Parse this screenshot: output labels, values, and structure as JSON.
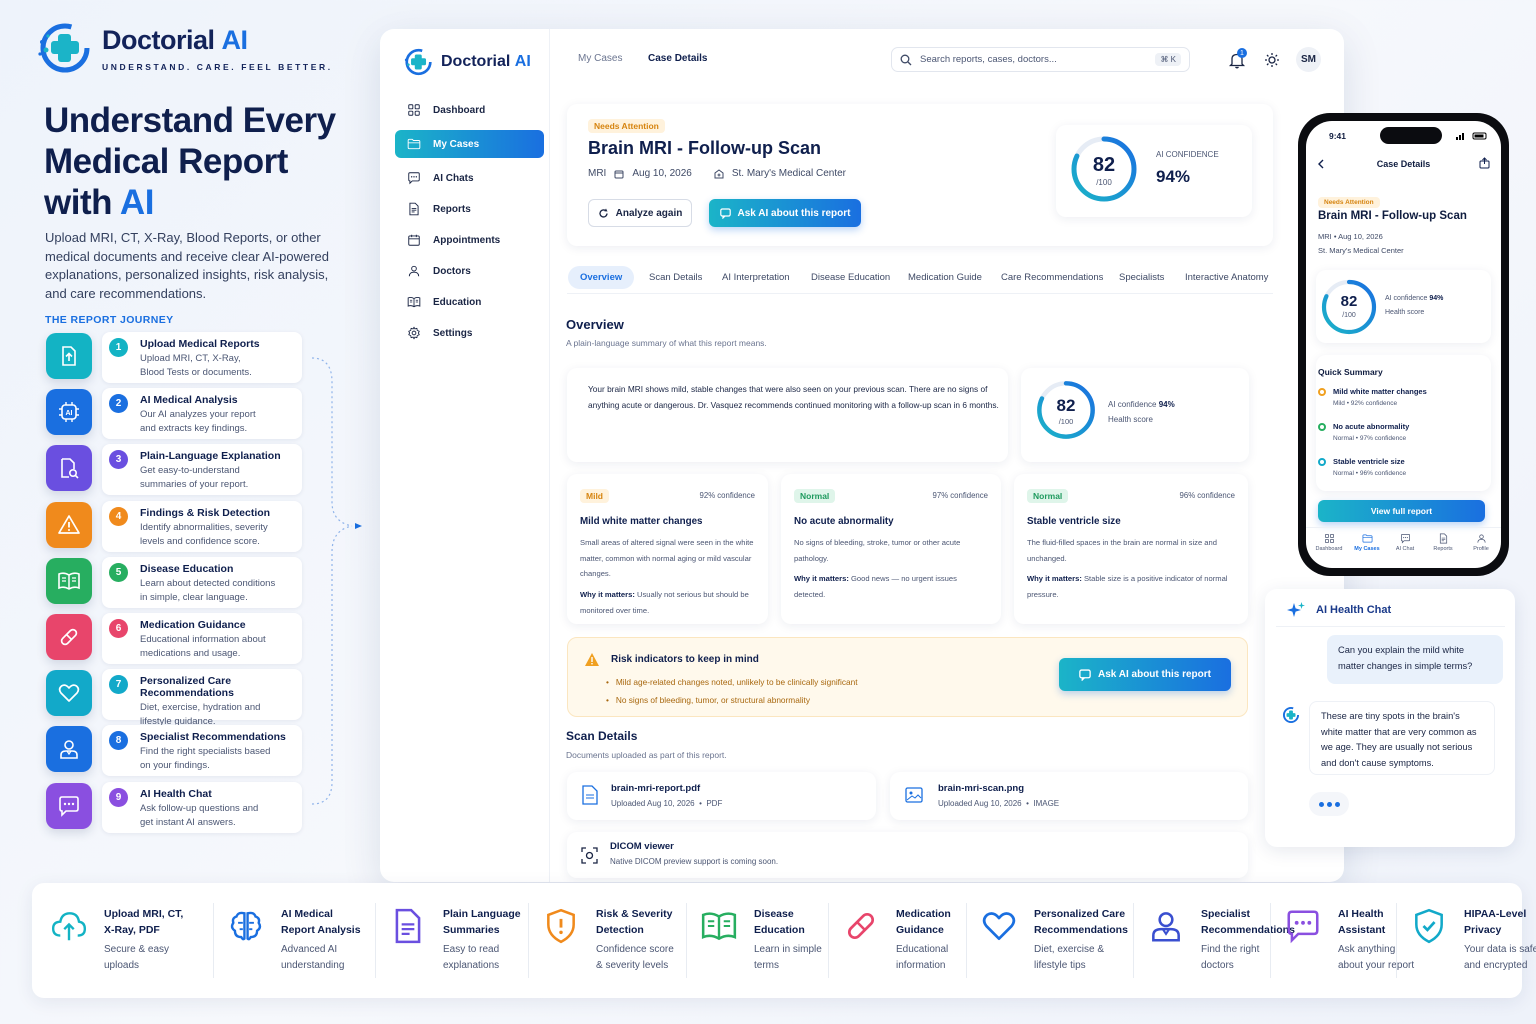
{
  "hero": {
    "brand_a": "Doctorial",
    "brand_b": "AI",
    "tagline": "UNDERSTAND. CARE. FEEL BETTER.",
    "title_a": "Understand Every Medical Report with",
    "title_b": "AI",
    "description": "Upload MRI, CT, X-Ray, Blood Reports, or other medical documents and receive clear AI-powered explanations, personalized insights, risk analysis, and care recommendations.",
    "journey_title": "THE REPORT JOURNEY"
  },
  "journey": [
    {
      "num": "1",
      "title": "Upload Medical Reports",
      "desc1": "Upload MRI, CT, X-Ray,",
      "desc2": "Blood Tests or documents.",
      "color": "#13b3c4",
      "icon": "upload-document-icon"
    },
    {
      "num": "2",
      "title": "AI Medical Analysis",
      "desc1": "Our AI analyzes your report",
      "desc2": "and extracts key findings.",
      "color": "#1a6fe0",
      "icon": "ai-chip-icon"
    },
    {
      "num": "3",
      "title": "Plain-Language Explanation",
      "desc1": "Get easy-to-understand",
      "desc2": "summaries of your report.",
      "color": "#6a4fe0",
      "icon": "document-search-icon"
    },
    {
      "num": "4",
      "title": "Findings & Risk Detection",
      "desc1": "Identify abnormalities, severity",
      "desc2": "levels and confidence score.",
      "color": "#f08a1c",
      "icon": "warning-icon"
    },
    {
      "num": "5",
      "title": "Disease Education",
      "desc1": "Learn about detected conditions",
      "desc2": "in simple, clear language.",
      "color": "#27ae60",
      "icon": "book-icon"
    },
    {
      "num": "6",
      "title": "Medication Guidance",
      "desc1": "Educational information about",
      "desc2": "medications and usage.",
      "color": "#e8456b",
      "icon": "pill-icon"
    },
    {
      "num": "7",
      "title": "Personalized Care Recommendations",
      "desc1": "Diet, exercise, hydration and",
      "desc2": "lifestyle guidance.",
      "color": "#12a9c9",
      "icon": "heart-icon"
    },
    {
      "num": "8",
      "title": "Specialist Recommendations",
      "desc1": "Find the right specialists based",
      "desc2": "on your findings.",
      "color": "#1a6fe0",
      "icon": "doctor-icon"
    },
    {
      "num": "9",
      "title": "AI Health Chat",
      "desc1": "Ask follow-up questions and",
      "desc2": "get instant AI answers.",
      "color": "#8a4fe0",
      "icon": "chat-icon"
    }
  ],
  "app": {
    "brand_a": "Doctorial",
    "brand_b": "AI",
    "nav": [
      {
        "label": "Dashboard",
        "icon": "grid-icon"
      },
      {
        "label": "My Cases",
        "icon": "folder-icon"
      },
      {
        "label": "AI Chats",
        "icon": "chat-icon"
      },
      {
        "label": "Reports",
        "icon": "document-icon"
      },
      {
        "label": "Appointments",
        "icon": "calendar-icon"
      },
      {
        "label": "Doctors",
        "icon": "user-icon"
      },
      {
        "label": "Education",
        "icon": "book-icon"
      },
      {
        "label": "Settings",
        "icon": "gear-icon"
      }
    ],
    "breadcrumb": {
      "parent": "My Cases",
      "current": "Case Details"
    },
    "search_placeholder": "Search reports, cases, doctors...",
    "shortcut": "⌘ K",
    "notifications": "1",
    "avatar": "SM",
    "case": {
      "badge": "Needs Attention",
      "title": "Brain MRI - Follow-up Scan",
      "type": "MRI",
      "date": "Aug 10, 2026",
      "facility": "St. Mary's Medical Center",
      "analyze_label": "Analyze again",
      "ask_label": "Ask AI about this report",
      "score": "82",
      "score_max": "/100",
      "score_value": 82,
      "confidence_label": "AI CONFIDENCE",
      "confidence": "94%"
    },
    "tabs": [
      "Overview",
      "Scan Details",
      "AI Interpretation",
      "Disease Education",
      "Medication Guide",
      "Care Recommendations",
      "Specialists",
      "Interactive Anatomy"
    ],
    "overview": {
      "title": "Overview",
      "subtitle": "A plain-language summary of what this report means.",
      "summary": "Your brain MRI shows mild, stable changes that were also seen on your previous scan. There are no signs of anything acute or dangerous. Dr. Vasquez recommends continued monitoring with a follow-up scan in 6 months.",
      "score": "82",
      "score_max": "/100",
      "confidence_prefix": "AI confidence",
      "confidence": "94%",
      "health_label": "Health score"
    },
    "findings": [
      {
        "badge": "Mild",
        "kind": "mild",
        "confidence": "92% confidence",
        "title": "Mild white matter changes",
        "desc": "Small areas of altered signal were seen in the white matter, common with normal aging or mild vascular changes.",
        "why_label": "Why it matters:",
        "why": " Usually not serious but should be monitored over time."
      },
      {
        "badge": "Normal",
        "kind": "norm",
        "confidence": "97% confidence",
        "title": "No acute abnormality",
        "desc": "No signs of bleeding, stroke, tumor or other acute pathology.",
        "why_label": "Why it matters:",
        "why": " Good news — no urgent issues detected."
      },
      {
        "badge": "Normal",
        "kind": "norm",
        "confidence": "96% confidence",
        "title": "Stable ventricle size",
        "desc": "The fluid-filled spaces in the brain are normal in size and unchanged.",
        "why_label": "Why it matters:",
        "why": " Stable size is a positive indicator of normal pressure."
      }
    ],
    "risk": {
      "title": "Risk indicators to keep in mind",
      "items": [
        "Mild age-related changes noted, unlikely to be clinically significant",
        "No signs of bleeding, tumor, or structural abnormality"
      ],
      "ask_label": "Ask AI about this report"
    },
    "scan": {
      "title": "Scan Details",
      "subtitle": "Documents uploaded as part of this report.",
      "files": [
        {
          "name": "brain-mri-report.pdf",
          "meta": "Uploaded Aug 10, 2026",
          "kind": "PDF"
        },
        {
          "name": "brain-mri-scan.png",
          "meta": "Uploaded Aug 10, 2026",
          "kind": "IMAGE"
        }
      ],
      "dicom_title": "DICOM viewer",
      "dicom_desc": "Native DICOM preview support is coming soon."
    }
  },
  "phone": {
    "time": "9:41",
    "title": "Case Details",
    "badge": "Needs Attention",
    "case_title": "Brain MRI - Follow-up Scan",
    "meta": "MRI  •  Aug 10, 2026",
    "facility": "St. Mary's Medical Center",
    "score": "82",
    "score_max": "/100",
    "conf_prefix": "AI confidence",
    "conf": "94%",
    "health": "Health score",
    "quick_title": "Quick Summary",
    "items": [
      {
        "title": "Mild white matter changes",
        "meta": "Mild  •  92% confidence",
        "color": "#f0a020"
      },
      {
        "title": "No acute abnormality",
        "meta": "Normal  •  97% confidence",
        "color": "#27ae60"
      },
      {
        "title": "Stable ventricle size",
        "meta": "Normal  •  96% confidence",
        "color": "#12a9c9"
      }
    ],
    "button": "View full report",
    "tabs": [
      "Dashboard",
      "My Cases",
      "AI Chat",
      "Reports",
      "Profile"
    ]
  },
  "chat": {
    "title": "AI Health Chat",
    "user_msg": "Can you explain the mild white matter changes in simple terms?",
    "ai_msg": "These are tiny spots in the brain's white matter that are very common as we age. They are usually not serious and don't cause symptoms."
  },
  "features": [
    {
      "t1": "Upload MRI, CT,",
      "t2": "X-Ray, PDF",
      "d1": "Secure & easy",
      "d2": "uploads",
      "icon": "cloud-upload-icon",
      "color": "#13b3c4"
    },
    {
      "t1": "AI Medical",
      "t2": "Report Analysis",
      "d1": "Advanced AI",
      "d2": "understanding",
      "icon": "brain-icon",
      "color": "#1a6fe0"
    },
    {
      "t1": "Plain Language",
      "t2": "Summaries",
      "d1": "Easy to read",
      "d2": "explanations",
      "icon": "document-icon",
      "color": "#6a4fe0"
    },
    {
      "t1": "Risk & Severity",
      "t2": "Detection",
      "d1": "Confidence score",
      "d2": "& severity levels",
      "icon": "shield-alert-icon",
      "color": "#f08a1c"
    },
    {
      "t1": "Disease",
      "t2": "Education",
      "d1": "Learn in simple",
      "d2": "terms",
      "icon": "book-icon",
      "color": "#27ae60"
    },
    {
      "t1": "Medication",
      "t2": "Guidance",
      "d1": "Educational",
      "d2": "information",
      "icon": "pill-icon",
      "color": "#e8456b"
    },
    {
      "t1": "Personalized Care",
      "t2": "Recommendations",
      "d1": "Diet, exercise &",
      "d2": "lifestyle tips",
      "icon": "heart-icon",
      "color": "#1a6fe0"
    },
    {
      "t1": "Specialist",
      "t2": "Recommendations",
      "d1": "Find the right",
      "d2": "doctors",
      "icon": "doctor-icon",
      "color": "#3a4fd0"
    },
    {
      "t1": "AI Health",
      "t2": "Assistant",
      "d1": "Ask anything",
      "d2": "about your report",
      "icon": "chat-bot-icon",
      "color": "#8a4fe0"
    },
    {
      "t1": "HIPAA-Level",
      "t2": "Privacy",
      "d1": "Your data is safe",
      "d2": "and encrypted",
      "icon": "shield-check-icon",
      "color": "#12a9c9"
    }
  ]
}
